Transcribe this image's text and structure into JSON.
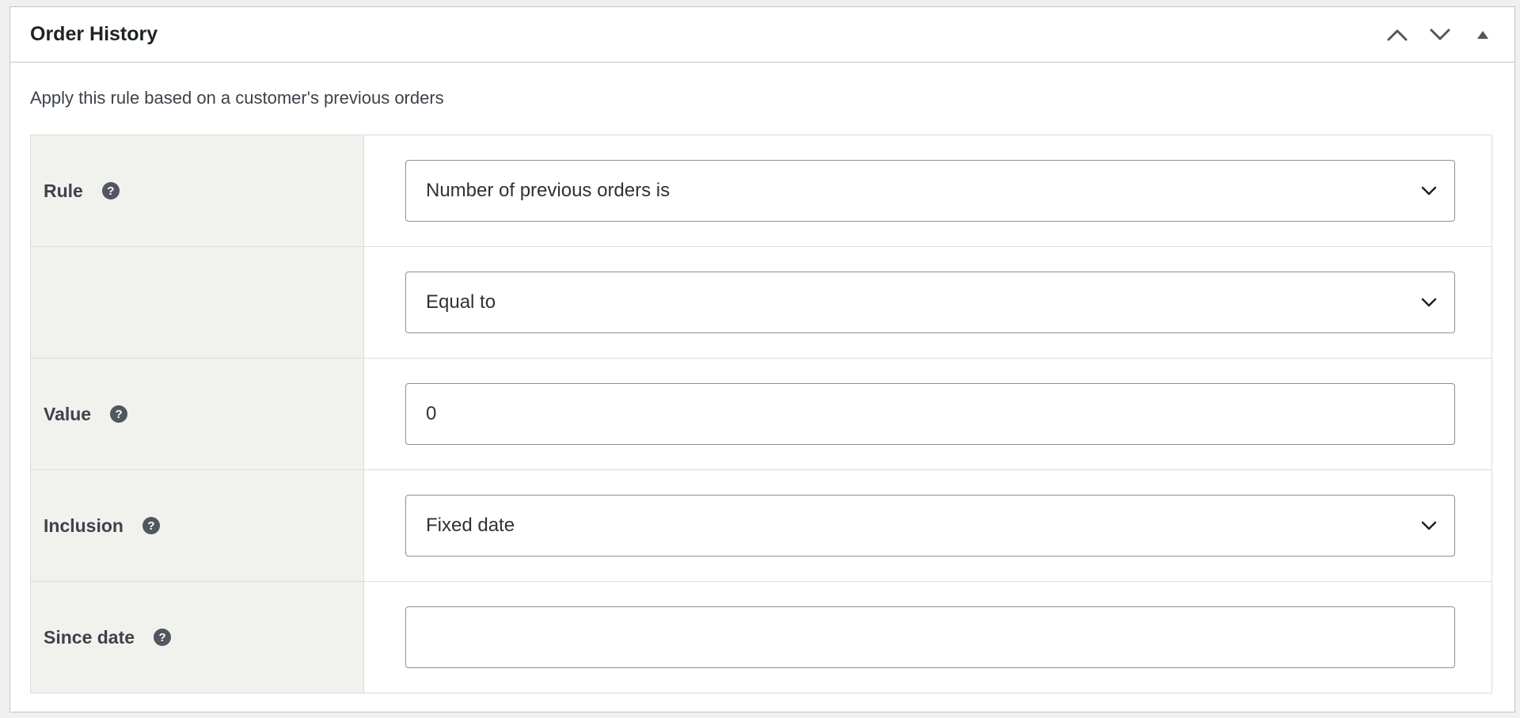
{
  "panel": {
    "title": "Order History",
    "description": "Apply this rule based on a customer's previous orders",
    "controls": {
      "move_up_icon": "chevron-up-icon",
      "move_down_icon": "chevron-down-icon",
      "toggle_icon": "triangle-up-icon"
    }
  },
  "rows": {
    "rule": {
      "label": "Rule",
      "help": "?",
      "selected": "Number of previous orders is"
    },
    "comparison": {
      "label": "",
      "selected": "Equal to"
    },
    "value": {
      "label": "Value",
      "help": "?",
      "input_value": "0"
    },
    "inclusion": {
      "label": "Inclusion",
      "help": "?",
      "selected": "Fixed date"
    },
    "since_date": {
      "label": "Since date",
      "help": "?",
      "input_value": ""
    }
  },
  "colors": {
    "label_bg": "#f1f1ee",
    "border": "#c3c4c7",
    "help_icon_bg": "#50575e"
  }
}
